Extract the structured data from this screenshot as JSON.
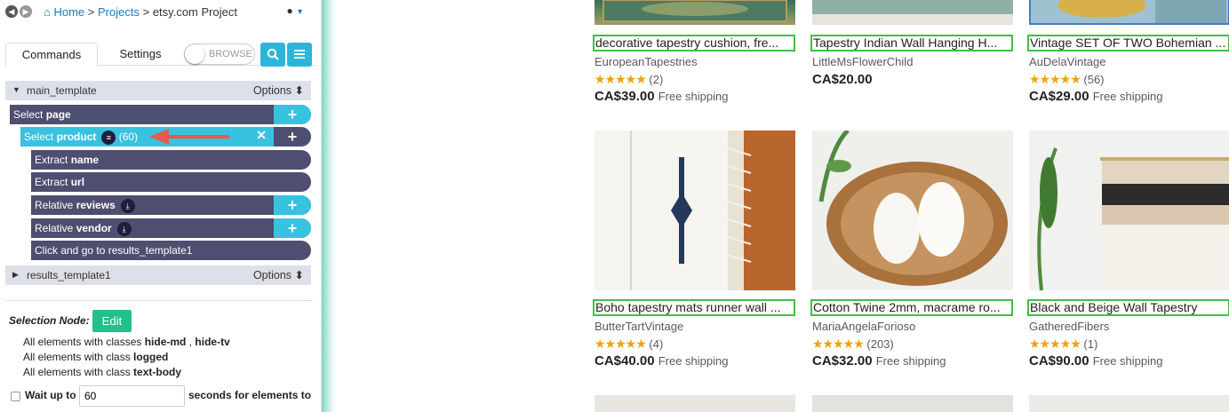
{
  "breadcrumb": {
    "home": "Home",
    "sep1": ">",
    "projects": "Projects",
    "sep2": ">",
    "current": "etsy.com Project"
  },
  "tabs": {
    "commands": "Commands",
    "settings": "Settings"
  },
  "browse_toggle": {
    "label": "BROWSE",
    "on": false
  },
  "templates": [
    {
      "name": "main_template",
      "options": "Options",
      "expanded": true
    },
    {
      "name": "results_template1",
      "options": "Options",
      "expanded": false
    }
  ],
  "commands": {
    "select_page": {
      "verb": "Select",
      "target": "page"
    },
    "select_product": {
      "verb": "Select",
      "target": "product",
      "count": "(60)"
    },
    "extract_name": {
      "verb": "Extract",
      "target": "name"
    },
    "extract_url": {
      "verb": "Extract",
      "target": "url"
    },
    "relative_reviews": {
      "verb": "Relative",
      "target": "reviews"
    },
    "relative_vendor": {
      "verb": "Relative",
      "target": "vendor"
    },
    "click_go": {
      "text": "Click and go to results_template1"
    }
  },
  "selection": {
    "label": "Selection Node:",
    "edit": "Edit",
    "lines": [
      {
        "prefix": "All elements with classes ",
        "b1": "hide-md",
        "mid": " , ",
        "b2": "hide-tv"
      },
      {
        "prefix": "All elements with class ",
        "b1": "logged"
      },
      {
        "prefix": "All elements with class ",
        "b1": "text-body"
      }
    ],
    "wait_label": "Wait up to",
    "wait_value": "60",
    "wait_suffix": "seconds for elements to"
  },
  "products_row1": [
    {
      "title": "decorative tapestry cushion, fre...",
      "shop": "EuropeanTapestries",
      "stars": "★★★★★",
      "reviews": "(2)",
      "price": "CA$39.00",
      "shipping": "Free shipping"
    },
    {
      "title": "Tapestry Indian Wall Hanging H...",
      "shop": "LittleMsFlowerChild",
      "price": "CA$20.00"
    },
    {
      "title": "Vintage SET OF TWO Bohemian ...",
      "shop": "AuDelaVintage",
      "stars": "★★★★★",
      "reviews": "(56)",
      "price": "CA$29.00",
      "shipping": "Free shipping"
    }
  ],
  "products_row2": [
    {
      "title": "Boho tapestry mats runner wall ...",
      "shop": "ButterTartVintage",
      "stars": "★★★★★",
      "reviews": "(4)",
      "price": "CA$40.00",
      "shipping": "Free shipping"
    },
    {
      "title": "Cotton Twine 2mm, macrame ro...",
      "shop": "MariaAngelaForioso",
      "stars": "★★★★★",
      "reviews": "(203)",
      "price": "CA$32.00",
      "shipping": "Free shipping"
    },
    {
      "title": "Black and Beige Wall Tapestry",
      "shop": "GatheredFibers",
      "stars": "★★★★★",
      "reviews": "(1)",
      "price": "CA$90.00",
      "shipping": "Free shipping"
    }
  ]
}
